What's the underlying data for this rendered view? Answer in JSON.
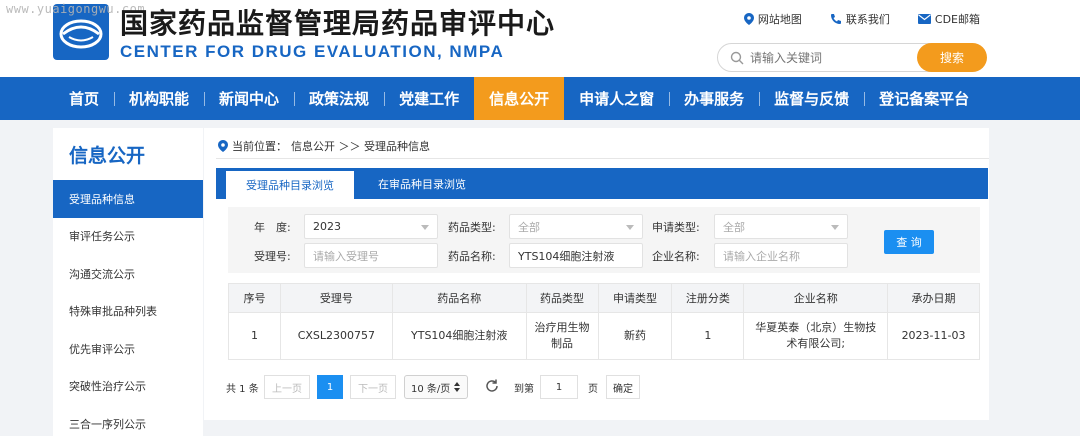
{
  "watermark": "www.yuaigongwu.com",
  "header": {
    "title_cn": "国家药品监督管理局药品审评中心",
    "title_en": "CENTER FOR DRUG EVALUATION, NMPA",
    "top_links": [
      {
        "label": "网站地图",
        "icon": "location-pin-icon"
      },
      {
        "label": "联系我们",
        "icon": "phone-icon"
      },
      {
        "label": "CDE邮箱",
        "icon": "mail-icon"
      }
    ],
    "search": {
      "placeholder": "请输入关键词",
      "button": "搜索"
    }
  },
  "nav": {
    "items": [
      "首页",
      "机构职能",
      "新闻中心",
      "政策法规",
      "党建工作",
      "信息公开",
      "申请人之窗",
      "办事服务",
      "监督与反馈",
      "登记备案平台"
    ],
    "active_index": 5
  },
  "sidebar": {
    "title": "信息公开",
    "items": [
      "受理品种信息",
      "审评任务公示",
      "沟通交流公示",
      "特殊审批品种列表",
      "优先审评公示",
      "突破性治疗公示",
      "三合一序列公示"
    ],
    "active_index": 0
  },
  "main": {
    "breadcrumb": {
      "prefix": "当前位置：",
      "path": "信息公开 ＞＞ 受理品种信息"
    },
    "tabs": [
      "受理品种目录浏览",
      "在审品种目录浏览"
    ],
    "active_tab": 0,
    "filter": {
      "year_label": "年　度:",
      "year_value": "2023",
      "drug_type_label": "药品类型:",
      "drug_type_value": "全部",
      "apply_type_label": "申请类型:",
      "apply_type_value": "全部",
      "accept_no_label": "受理号:",
      "accept_no_placeholder": "请输入受理号",
      "drug_name_label": "药品名称:",
      "drug_name_value": "YTS104细胞注射液",
      "company_label": "企业名称:",
      "company_placeholder": "请输入企业名称",
      "query_button": "查 询"
    },
    "table": {
      "columns": [
        "序号",
        "受理号",
        "药品名称",
        "药品类型",
        "申请类型",
        "注册分类",
        "企业名称",
        "承办日期"
      ],
      "rows": [
        [
          "1",
          "CXSL2300757",
          "YTS104细胞注射液",
          "治疗用生物制品",
          "新药",
          "1",
          "华夏英泰（北京）生物技术有限公司;",
          "2023-11-03"
        ]
      ]
    },
    "pager": {
      "total_text": "共 1 条",
      "prev": "上一页",
      "current_page": "1",
      "next": "下一页",
      "page_size": "10 条/页",
      "goto_label": "到第",
      "goto_value": "1",
      "page_unit": "页",
      "confirm": "确定"
    }
  },
  "colors": {
    "primary": "#1766c3",
    "accent": "#f39b1d",
    "button": "#1b8ff1"
  }
}
